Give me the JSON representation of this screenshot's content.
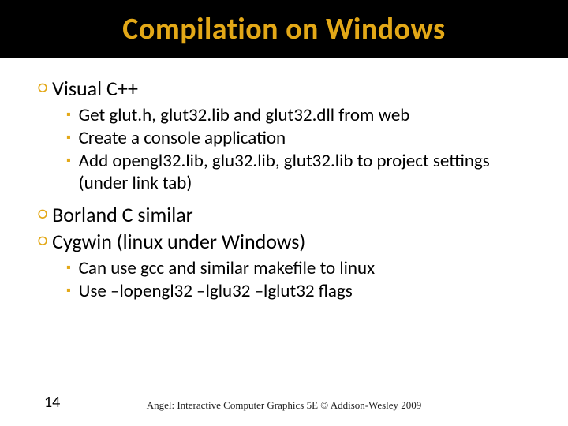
{
  "title": "Compilation on Windows",
  "bullets": {
    "b0": {
      "text": "Visual C++"
    },
    "b0_sub": {
      "s0": "Get glut.h, glut32.lib and glut32.dll from web",
      "s1": "Create a console application",
      "s2": "Add opengl32.lib, glu32.lib, glut32.lib to project settings (under link tab)"
    },
    "b1": {
      "text": "Borland C similar"
    },
    "b2": {
      "text": "Cygwin (linux under Windows)"
    },
    "b2_sub": {
      "s0": "Can use gcc and similar makefile to linux",
      "s1": "Use –lopengl32 –lglu32 –lglut32 flags"
    }
  },
  "slide_number": "14",
  "footer": "Angel: Interactive Computer Graphics 5E © Addison-Wesley 2009",
  "chart_data": null
}
